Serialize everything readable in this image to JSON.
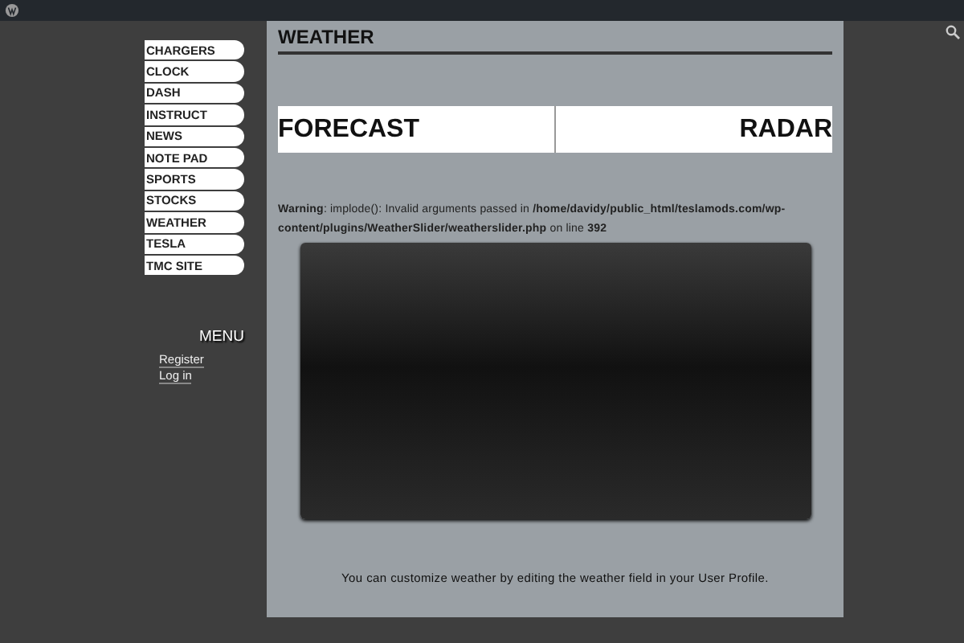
{
  "nav": [
    {
      "label": "CHARGERS"
    },
    {
      "label": "CLOCK"
    },
    {
      "label": "DASH"
    },
    {
      "label": "INSTRUCT"
    },
    {
      "label": "NEWS"
    },
    {
      "label": "NOTE PAD"
    },
    {
      "label": "SPORTS"
    },
    {
      "label": "STOCKS"
    },
    {
      "label": "WEATHER"
    },
    {
      "label": "TESLA"
    },
    {
      "label": "TMC SITE"
    }
  ],
  "menu": {
    "title": "MENU",
    "links": [
      "Register",
      "Log in"
    ]
  },
  "page": {
    "title": "WEATHER",
    "tabs": [
      "FORECAST",
      "RADAR"
    ],
    "warning": "**Warning**: implode(): Invalid arguments passed in **/home/davidy/public_html/teslamods.com/wp-content/plugins/WeatherSlider/weatherslider.php** on line **392**",
    "footer": "You can customize weather by editing the weather field in your User Profile."
  }
}
